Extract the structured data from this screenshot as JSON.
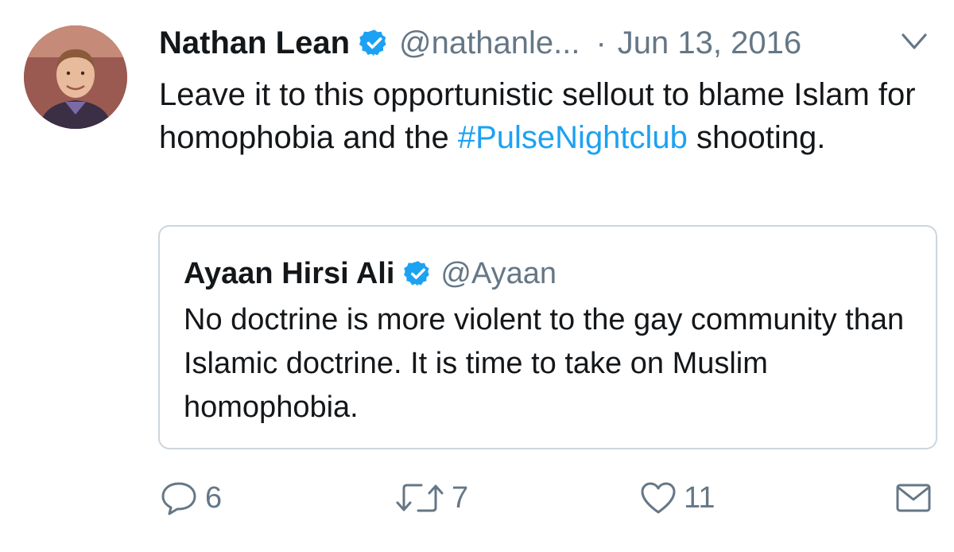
{
  "tweet": {
    "author_name": "Nathan Lean",
    "handle": "@nathanle...",
    "separator": "·",
    "date": "Jun 13, 2016",
    "text_before": "Leave it to this opportunistic sellout to blame Islam for homophobia and the ",
    "hashtag": "#PulseNightclub",
    "text_after": " shooting."
  },
  "quoted": {
    "author_name": "Ayaan Hirsi Ali",
    "handle": "@Ayaan",
    "text": "No doctrine is more violent to the gay community than Islamic doctrine. It is time to take on Muslim homophobia."
  },
  "actions": {
    "replies": "6",
    "retweets": "7",
    "likes": "11"
  },
  "icons": {
    "verified": "verified-badge-icon",
    "more": "chevron-down-icon",
    "reply": "reply-icon",
    "retweet": "retweet-icon",
    "like": "heart-icon",
    "dm": "envelope-icon"
  },
  "colors": {
    "text": "#14171a",
    "secondary": "#657786",
    "link": "#1da1f2",
    "border": "#ccd6dd"
  }
}
